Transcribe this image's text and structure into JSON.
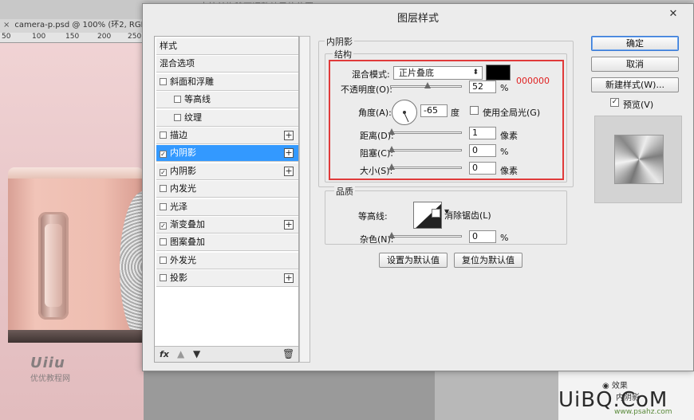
{
  "background": {
    "hint_text": "点拉并拖移可调整效果的位置。",
    "doc_tab": "camera-p.psd @ 100% (环2, RGB",
    "doc_tab_close": "×",
    "ruler_ticks": [
      "50",
      "100",
      "150",
      "200",
      "250"
    ],
    "watermark_logo": "Uiiu",
    "watermark_sub": "优优教程网",
    "right_panel_effects": "效果",
    "right_panel_item": "内阴影",
    "site_watermark": "UiBQ.CoM",
    "site_watermark_sub": "www.psahz.com"
  },
  "dialog": {
    "title": "图层样式",
    "close_label": "✕",
    "style_list": {
      "items": [
        {
          "label": "样式",
          "checkbox": false,
          "plus": false,
          "indent": 0,
          "selected": false,
          "checked": false
        },
        {
          "label": "混合选项",
          "checkbox": false,
          "plus": false,
          "indent": 0,
          "selected": false,
          "checked": false
        },
        {
          "label": "斜面和浮雕",
          "checkbox": true,
          "plus": false,
          "indent": 0,
          "selected": false,
          "checked": false
        },
        {
          "label": "等高线",
          "checkbox": true,
          "plus": false,
          "indent": 1,
          "selected": false,
          "checked": false
        },
        {
          "label": "纹理",
          "checkbox": true,
          "plus": false,
          "indent": 1,
          "selected": false,
          "checked": false
        },
        {
          "label": "描边",
          "checkbox": true,
          "plus": true,
          "indent": 0,
          "selected": false,
          "checked": false
        },
        {
          "label": "内阴影",
          "checkbox": true,
          "plus": true,
          "indent": 0,
          "selected": true,
          "checked": true
        },
        {
          "label": "内阴影",
          "checkbox": true,
          "plus": true,
          "indent": 0,
          "selected": false,
          "checked": true
        },
        {
          "label": "内发光",
          "checkbox": true,
          "plus": false,
          "indent": 0,
          "selected": false,
          "checked": false
        },
        {
          "label": "光泽",
          "checkbox": true,
          "plus": false,
          "indent": 0,
          "selected": false,
          "checked": false
        },
        {
          "label": "渐变叠加",
          "checkbox": true,
          "plus": true,
          "indent": 0,
          "selected": false,
          "checked": true
        },
        {
          "label": "图案叠加",
          "checkbox": true,
          "plus": false,
          "indent": 0,
          "selected": false,
          "checked": false
        },
        {
          "label": "外发光",
          "checkbox": true,
          "plus": false,
          "indent": 0,
          "selected": false,
          "checked": false
        },
        {
          "label": "投影",
          "checkbox": true,
          "plus": true,
          "indent": 0,
          "selected": false,
          "checked": false
        }
      ],
      "footer": {
        "fx_label": "fx",
        "up_icon": "arrow-up-icon",
        "down_icon": "arrow-down-icon",
        "trash_icon": "trash-icon"
      }
    },
    "inner_shadow": {
      "section_title": "内阴影",
      "structure_title": "结构",
      "blend_mode_label": "混合模式:",
      "blend_mode_value": "正片叠底",
      "shadow_color": "#000000",
      "color_annotation": "000000",
      "opacity_label": "不透明度(O):",
      "opacity_value": "52",
      "opacity_unit": "%",
      "opacity_level": 0.52,
      "angle_label": "角度(A):",
      "angle_value": "-65",
      "angle_unit": "度",
      "global_light_label": "使用全局光(G)",
      "global_light_checked": false,
      "distance_label": "距离(D):",
      "distance_value": "1",
      "distance_unit": "像素",
      "choke_label": "阻塞(C):",
      "choke_value": "0",
      "choke_unit": "%",
      "size_label": "大小(S):",
      "size_value": "0",
      "size_unit": "像素"
    },
    "quality": {
      "title": "品质",
      "contour_label": "等高线:",
      "antialias_label": "消除锯齿(L)",
      "antialias_checked": false,
      "noise_label": "杂色(N):",
      "noise_value": "0",
      "noise_unit": "%"
    },
    "buttons": {
      "make_default": "设置为默认值",
      "reset_default": "复位为默认值",
      "ok": "确定",
      "cancel": "取消",
      "new_style": "新建样式(W)...",
      "preview_label": "预览(V)",
      "preview_checked": true
    }
  }
}
